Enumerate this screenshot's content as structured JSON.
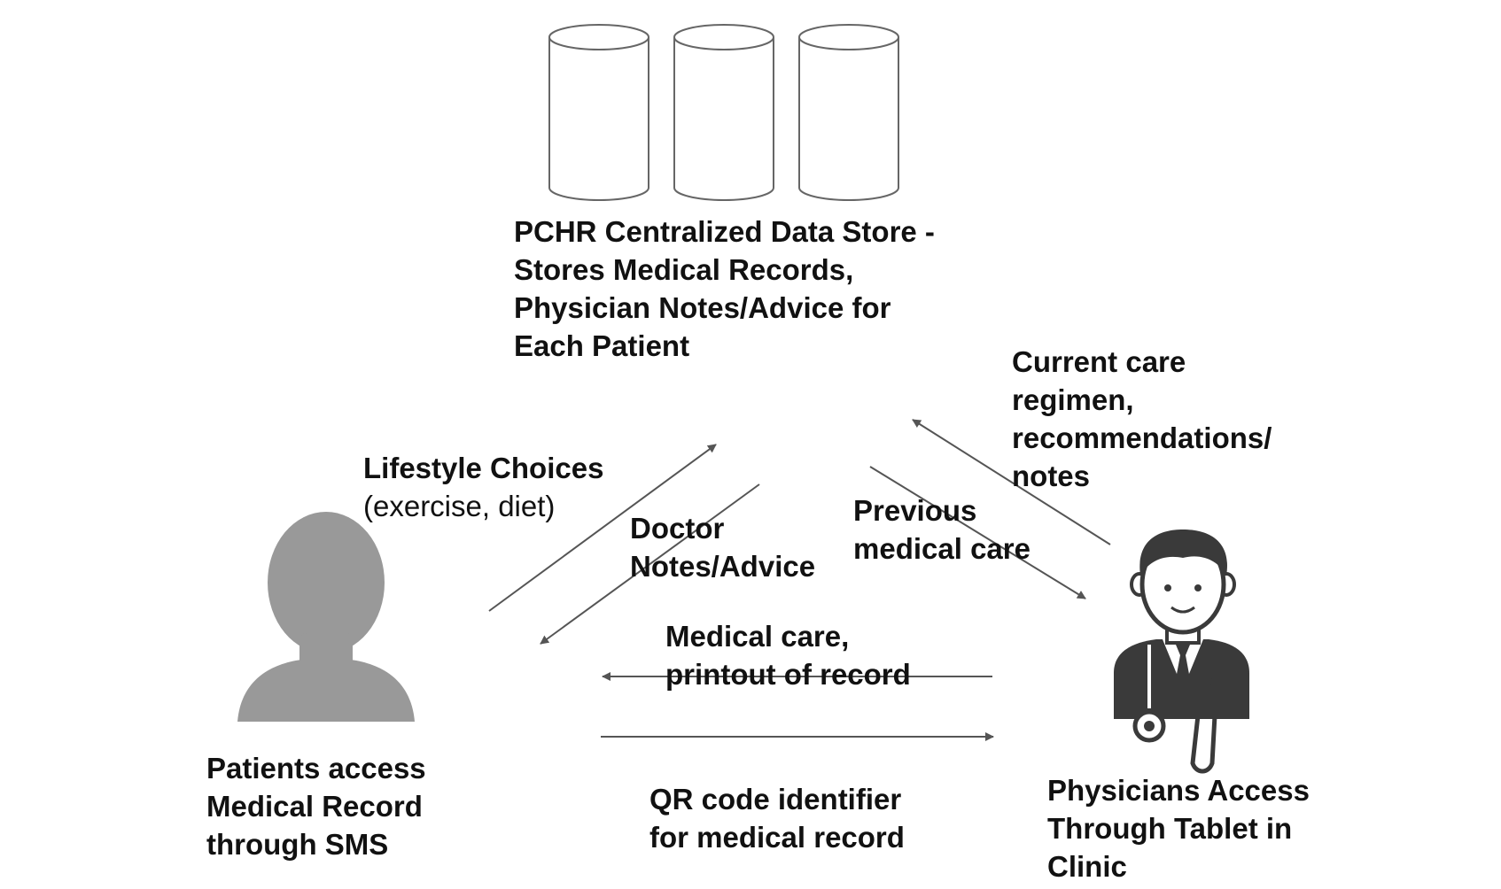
{
  "datastore": {
    "lines": [
      "PCHR Centralized Data Store -",
      "Stores Medical Records,",
      "Physician Notes/Advice for",
      "Each Patient"
    ]
  },
  "edges": {
    "current_care": {
      "lines": [
        "Current care",
        "regimen,",
        "recommendations/",
        "notes"
      ]
    },
    "lifestyle": {
      "title": "Lifestyle Choices",
      "detail": "(exercise, diet)"
    },
    "doctor_notes": {
      "lines": [
        "Doctor",
        "Notes/Advice"
      ]
    },
    "previous_care": {
      "lines": [
        "Previous",
        "medical care"
      ]
    },
    "medical_care": {
      "lines": [
        "Medical care,",
        "printout of record"
      ]
    },
    "qr_code": {
      "lines": [
        "QR code identifier",
        "for medical record"
      ]
    }
  },
  "patient": {
    "lines": [
      "Patients access",
      "Medical Record",
      "through SMS"
    ]
  },
  "physician": {
    "lines": [
      "Physicians Access",
      "Through Tablet in",
      "Clinic"
    ]
  },
  "colors": {
    "arrow": "#555555",
    "patient_icon": "#999999",
    "physician_icon": "#3a3a3a"
  }
}
